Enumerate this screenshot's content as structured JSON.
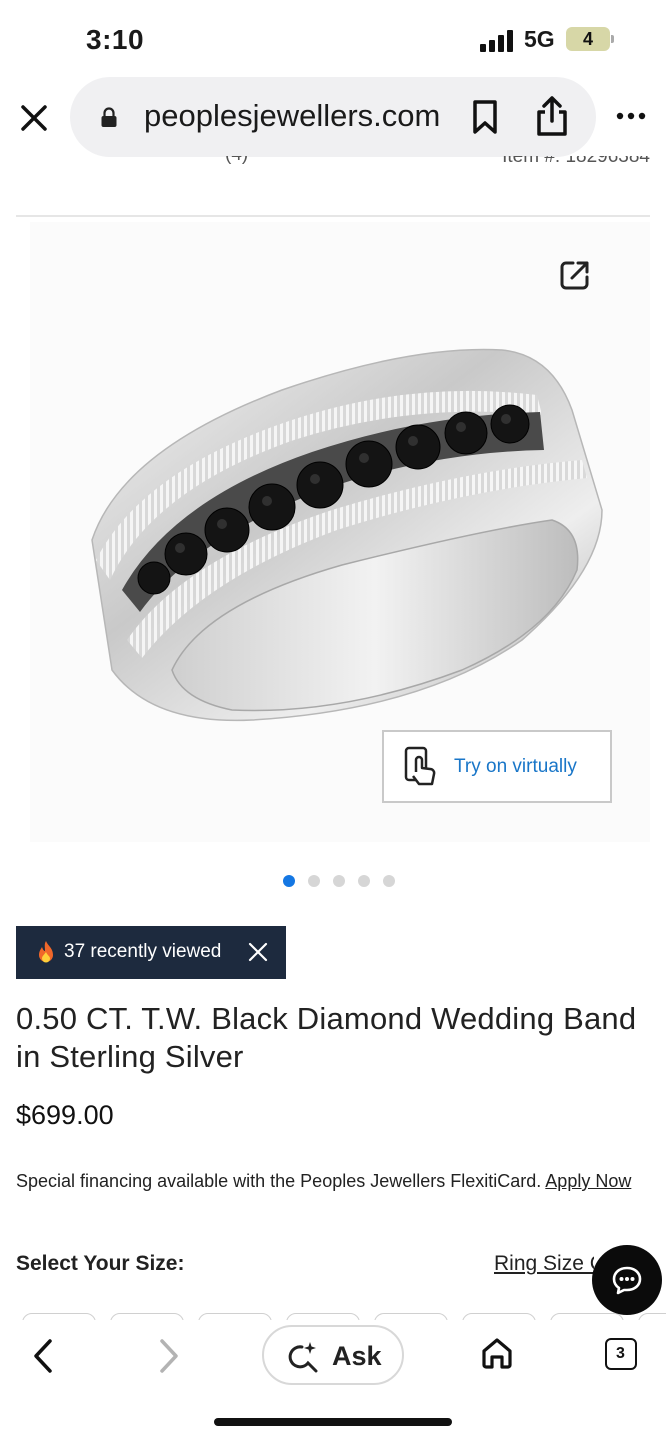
{
  "status_bar": {
    "time": "3:10",
    "network": "5G",
    "battery": "4"
  },
  "browser": {
    "url": "peoplesjewellers.com",
    "icons": {
      "close": "close-icon",
      "lock": "lock-icon",
      "bookmark": "bookmark-icon",
      "share": "share-icon",
      "more": "more-icon"
    }
  },
  "header": {
    "item_number": "Item #: 18296384",
    "review_count": "(4)"
  },
  "gallery": {
    "try_on_label": "Try on virtually",
    "slide_count": 5,
    "active_slide": 1
  },
  "popularity": {
    "text": "37 recently viewed"
  },
  "product": {
    "title": "0.50 CT. T.W. Black Diamond Wedding Band in Sterling Silver",
    "price": "$699.00",
    "financing_text": "Special financing available with the Peoples Jewellers FlexitiCard.",
    "financing_link": "Apply Now"
  },
  "size": {
    "label": "Select Your Size:",
    "chart_link": "Ring Size Chart"
  },
  "toolbar": {
    "ask_label": "Ask",
    "tab_count": "3"
  },
  "colors": {
    "accent": "#1477e3",
    "banner": "#1d2a3e",
    "link_blue": "#1976c8"
  }
}
